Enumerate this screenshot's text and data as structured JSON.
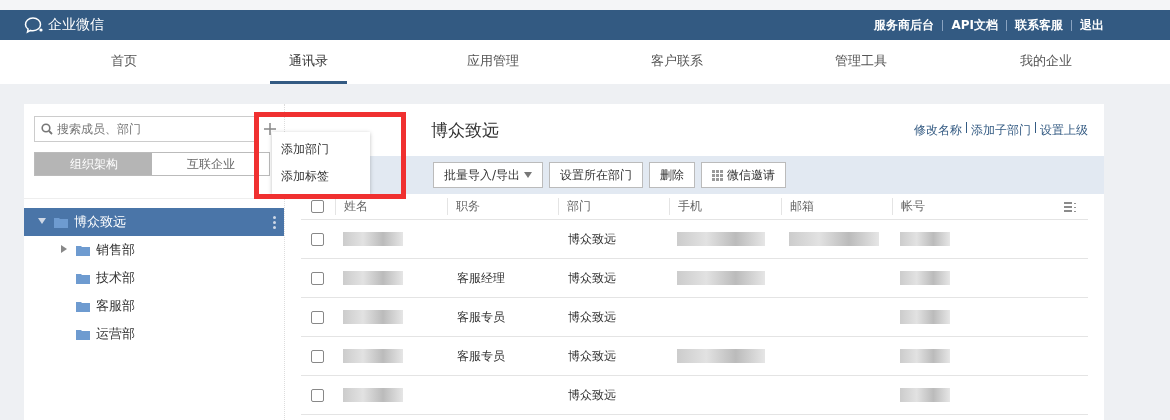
{
  "header": {
    "logo": "企业微信",
    "links": [
      "服务商后台",
      "API文档",
      "联系客服",
      "退出"
    ]
  },
  "nav": [
    {
      "label": "首页",
      "selected": false
    },
    {
      "label": "通讯录",
      "selected": true
    },
    {
      "label": "应用管理",
      "selected": false
    },
    {
      "label": "客户联系",
      "selected": false
    },
    {
      "label": "管理工具",
      "selected": false
    },
    {
      "label": "我的企业",
      "selected": false
    }
  ],
  "sidebar": {
    "search": {
      "placeholder": "搜索成员、部门"
    },
    "segments": [
      {
        "label": "组织架构",
        "selected": true
      },
      {
        "label": "互联企业",
        "selected": false
      }
    ],
    "tree": [
      {
        "label": "博众致远",
        "expanded": true,
        "selected": true,
        "children": [
          {
            "label": "销售部",
            "expanded": false,
            "selected": false
          },
          {
            "label": "技术部",
            "selected": false
          },
          {
            "label": "客服部",
            "selected": false
          },
          {
            "label": "运营部",
            "selected": false
          }
        ]
      }
    ]
  },
  "add_menu": {
    "items": [
      "添加部门",
      "添加标签"
    ]
  },
  "department": {
    "title": "博众致远",
    "actions": [
      "修改名称",
      "添加子部门",
      "设置上级"
    ]
  },
  "toolbar": [
    {
      "label": "批量导入/导出",
      "kind": "dropdown"
    },
    {
      "label": "设置所在部门",
      "kind": "plain"
    },
    {
      "label": "删除",
      "kind": "plain"
    },
    {
      "label": "微信邀请",
      "kind": "icon"
    }
  ],
  "table": {
    "select_all": {
      "checked": false
    },
    "columns": [
      "姓名",
      "职务",
      "部门",
      "手机",
      "邮箱",
      "帐号"
    ],
    "rows": [
      {
        "checked": false,
        "position": "",
        "department": "博众致远",
        "phone_hidden": true,
        "email_hidden": true
      },
      {
        "checked": false,
        "position": "客服经理",
        "department": "博众致远",
        "phone_hidden": true,
        "email_hidden": false
      },
      {
        "checked": false,
        "position": "客服专员",
        "department": "博众致远",
        "phone_hidden": false,
        "email_hidden": false
      },
      {
        "checked": false,
        "position": "客服专员",
        "department": "博众致远",
        "phone_hidden": true,
        "email_hidden": false
      },
      {
        "checked": false,
        "position": "",
        "department": "博众致远",
        "phone_hidden": false,
        "email_hidden": false
      }
    ]
  }
}
